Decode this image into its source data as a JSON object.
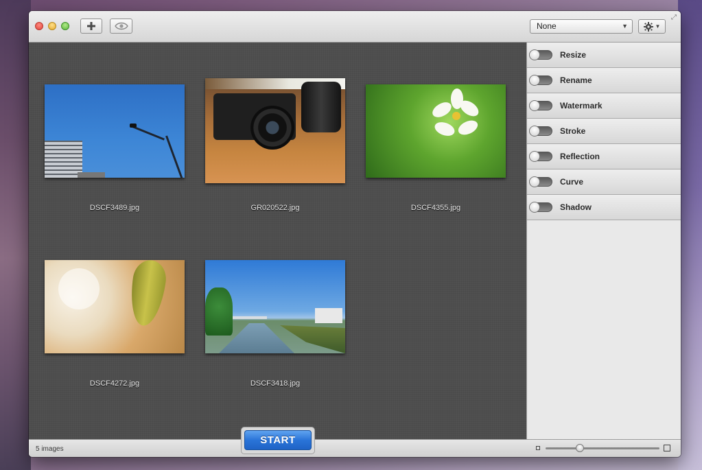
{
  "toolbar": {
    "add_icon": "plus-icon",
    "preview_icon": "eye-icon",
    "preset_select": {
      "selected": "None"
    },
    "gear_icon": "gear-icon",
    "fullscreen_icon": "fullscreen-icon"
  },
  "images": [
    {
      "filename": "DSCF3489.jpg"
    },
    {
      "filename": "GR020522.jpg"
    },
    {
      "filename": "DSCF4355.jpg"
    },
    {
      "filename": "DSCF4272.jpg"
    },
    {
      "filename": "DSCF3418.jpg"
    }
  ],
  "sidebar": {
    "items": [
      {
        "label": "Resize",
        "enabled": false
      },
      {
        "label": "Rename",
        "enabled": false
      },
      {
        "label": "Watermark",
        "enabled": false
      },
      {
        "label": "Stroke",
        "enabled": false
      },
      {
        "label": "Reflection",
        "enabled": false
      },
      {
        "label": "Curve",
        "enabled": false
      },
      {
        "label": "Shadow",
        "enabled": false
      }
    ]
  },
  "statusbar": {
    "count_text": "5 images",
    "start_label": "START",
    "zoom_level": 0.3
  },
  "colors": {
    "accent": "#2a74d8",
    "canvas_bg": "#4e4e4e"
  }
}
